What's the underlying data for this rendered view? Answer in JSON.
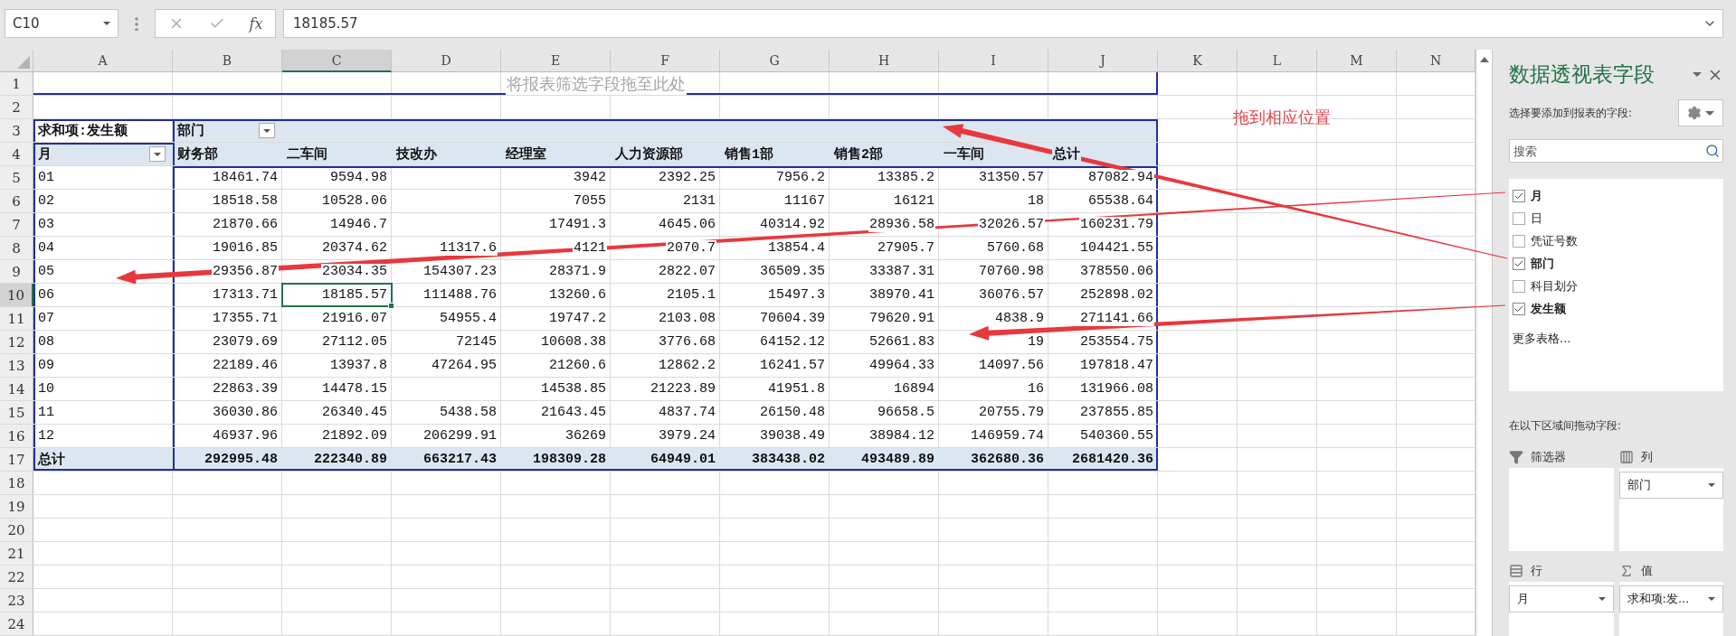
{
  "formula_bar": {
    "name_box": "C10",
    "function_button": "fx",
    "value": "18185.57"
  },
  "columns": [
    {
      "label": "A",
      "selected": false
    },
    {
      "label": "B",
      "selected": false
    },
    {
      "label": "C",
      "selected": true
    },
    {
      "label": "D",
      "selected": false
    },
    {
      "label": "E",
      "selected": false
    },
    {
      "label": "F",
      "selected": false
    },
    {
      "label": "G",
      "selected": false
    },
    {
      "label": "H",
      "selected": false
    },
    {
      "label": "I",
      "selected": false
    },
    {
      "label": "J",
      "selected": false
    },
    {
      "label": "K",
      "selected": false
    },
    {
      "label": "L",
      "selected": false
    },
    {
      "label": "M",
      "selected": false
    },
    {
      "label": "N",
      "selected": false
    }
  ],
  "rows": [
    {
      "label": "1",
      "selected": false
    },
    {
      "label": "2",
      "selected": false
    },
    {
      "label": "3",
      "selected": false
    },
    {
      "label": "4",
      "selected": false
    },
    {
      "label": "5",
      "selected": false
    },
    {
      "label": "6",
      "selected": false
    },
    {
      "label": "7",
      "selected": false
    },
    {
      "label": "8",
      "selected": false
    },
    {
      "label": "9",
      "selected": false
    },
    {
      "label": "10",
      "selected": true
    },
    {
      "label": "11",
      "selected": false
    },
    {
      "label": "12",
      "selected": false
    },
    {
      "label": "13",
      "selected": false
    },
    {
      "label": "14",
      "selected": false
    },
    {
      "label": "15",
      "selected": false
    },
    {
      "label": "16",
      "selected": false
    },
    {
      "label": "17",
      "selected": false
    },
    {
      "label": "18",
      "selected": false
    },
    {
      "label": "19",
      "selected": false
    },
    {
      "label": "20",
      "selected": false
    },
    {
      "label": "21",
      "selected": false
    },
    {
      "label": "22",
      "selected": false
    },
    {
      "label": "23",
      "selected": false
    },
    {
      "label": "24",
      "selected": false
    }
  ],
  "pivot": {
    "filter_hint": "将报表筛选字段拖至此处",
    "value_label": "求和项:发生额",
    "column_field": "部门",
    "row_field": "月",
    "column_headers": [
      "财务部",
      "二车间",
      "技改办",
      "经理室",
      "人力资源部",
      "销售1部",
      "销售2部",
      "一车间",
      "总计"
    ],
    "data_rows": [
      {
        "label": "01",
        "values": {
          "column_1": "18461.74",
          "column_2": "9594.98",
          "column_4": "3942",
          "column_5": "2392.25",
          "column_6": "7956.2",
          "column_7": "13385.2",
          "column_8": "31350.57",
          "column_9": "87082.94"
        }
      },
      {
        "label": "02",
        "values": {
          "column_1": "18518.58",
          "column_2": "10528.06",
          "column_4": "7055",
          "column_5": "2131",
          "column_6": "11167",
          "column_7": "16121",
          "column_8": "18",
          "column_9": "65538.64"
        }
      },
      {
        "label": "03",
        "values": {
          "column_1": "21870.66",
          "column_2": "14946.7",
          "column_4": "17491.3",
          "column_5": "4645.06",
          "column_6": "40314.92",
          "column_7": "28936.58",
          "column_8": "32026.57",
          "column_9": "160231.79"
        }
      },
      {
        "label": "04",
        "values": {
          "column_1": "19016.85",
          "column_2": "20374.62",
          "column_3": "11317.6",
          "column_4": "4121",
          "column_5": "2070.7",
          "column_6": "13854.4",
          "column_7": "27905.7",
          "column_8": "5760.68",
          "column_9": "104421.55"
        }
      },
      {
        "label": "05",
        "values": {
          "column_1": "29356.87",
          "column_2": "23034.35",
          "column_3": "154307.23",
          "column_4": "28371.9",
          "column_5": "2822.07",
          "column_6": "36509.35",
          "column_7": "33387.31",
          "column_8": "70760.98",
          "column_9": "378550.06"
        }
      },
      {
        "label": "06",
        "values": {
          "column_1": "17313.71",
          "column_2": "18185.57",
          "column_3": "111488.76",
          "column_4": "13260.6",
          "column_5": "2105.1",
          "column_6": "15497.3",
          "column_7": "38970.41",
          "column_8": "36076.57",
          "column_9": "252898.02"
        }
      },
      {
        "label": "07",
        "values": {
          "column_1": "17355.71",
          "column_2": "21916.07",
          "column_3": "54955.4",
          "column_4": "19747.2",
          "column_5": "2103.08",
          "column_6": "70604.39",
          "column_7": "79620.91",
          "column_8": "4838.9",
          "column_9": "271141.66"
        }
      },
      {
        "label": "08",
        "values": {
          "column_1": "23079.69",
          "column_2": "27112.05",
          "column_3": "72145",
          "column_4": "10608.38",
          "column_5": "3776.68",
          "column_6": "64152.12",
          "column_7": "52661.83",
          "column_8": "19",
          "column_9": "253554.75"
        }
      },
      {
        "label": "09",
        "values": {
          "column_1": "22189.46",
          "column_2": "13937.8",
          "column_3": "47264.95",
          "column_4": "21260.6",
          "column_5": "12862.2",
          "column_6": "16241.57",
          "column_7": "49964.33",
          "column_8": "14097.56",
          "column_9": "197818.47"
        }
      },
      {
        "label": "10",
        "values": {
          "column_1": "22863.39",
          "column_2": "14478.15",
          "column_4": "14538.85",
          "column_5": "21223.89",
          "column_6": "41951.8",
          "column_7": "16894",
          "column_8": "16",
          "column_9": "131966.08"
        }
      },
      {
        "label": "11",
        "values": {
          "column_1": "36030.86",
          "column_2": "26340.45",
          "column_3": "5438.58",
          "column_4": "21643.45",
          "column_5": "4837.74",
          "column_6": "26150.48",
          "column_7": "96658.5",
          "column_8": "20755.79",
          "column_9": "237855.85"
        }
      },
      {
        "label": "12",
        "values": {
          "column_1": "46937.96",
          "column_2": "21892.09",
          "column_3": "206299.91",
          "column_4": "36269",
          "column_5": "3979.24",
          "column_6": "39038.49",
          "column_7": "38984.12",
          "column_8": "146959.74",
          "column_9": "540360.55"
        }
      }
    ],
    "total": {
      "label": "总计",
      "values": {
        "column_1": "292995.48",
        "column_2": "222340.89",
        "column_3": "663217.43",
        "column_4": "198309.28",
        "column_5": "64949.01",
        "column_6": "383438.02",
        "column_7": "493489.89",
        "column_8": "362680.36",
        "column_9": "2681420.36"
      }
    }
  },
  "annotation": "拖到相应位置",
  "panel": {
    "title": "数据透视表字段",
    "prompt": "选择要添加到报表的字段:",
    "search": {
      "placeholder": "搜索"
    },
    "fields": [
      {
        "label": "月",
        "checked": true
      },
      {
        "label": "日",
        "checked": false
      },
      {
        "label": "凭证号数",
        "checked": false
      },
      {
        "label": "部门",
        "checked": true
      },
      {
        "label": "科目划分",
        "checked": false
      },
      {
        "label": "发生额",
        "checked": true
      }
    ],
    "more_tables": "更多表格...",
    "areas_prompt": "在以下区域间拖动字段:",
    "areas": [
      {
        "kind": "filter",
        "label": "筛选器"
      },
      {
        "kind": "columns",
        "label": "列",
        "items": [
          "部门"
        ]
      },
      {
        "kind": "rows",
        "label": "行",
        "items": [
          "月"
        ]
      },
      {
        "kind": "values",
        "label": "值",
        "items": [
          "求和项:发..."
        ]
      }
    ]
  }
}
